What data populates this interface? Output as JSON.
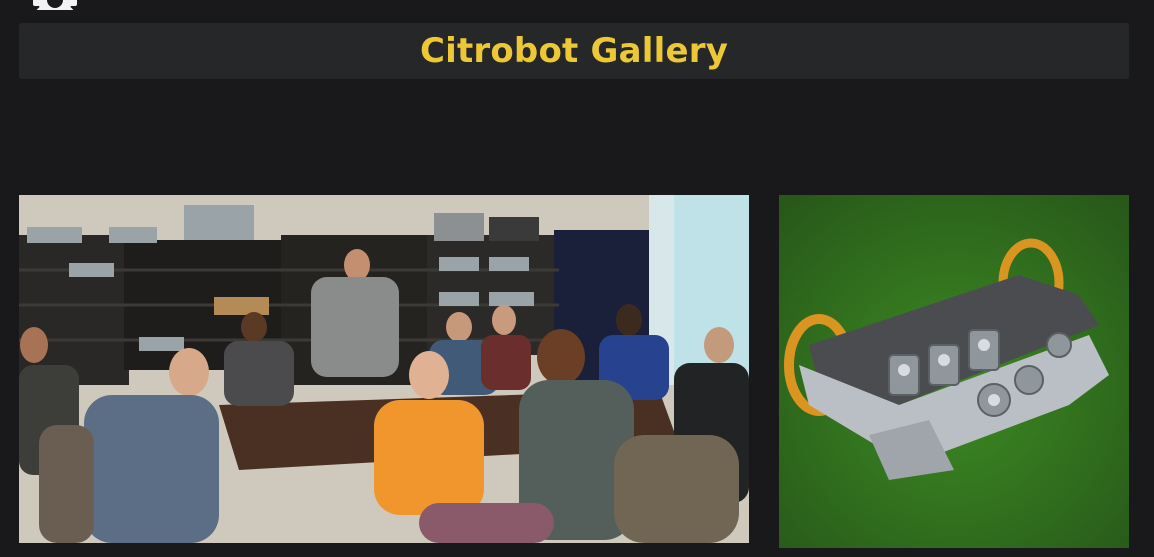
{
  "header": {
    "logo_icon": "gear-icon",
    "title": "Citrobot Gallery",
    "title_color": "#ecc836"
  },
  "gallery": {
    "items": [
      {
        "icon": "team-photo",
        "kind": "photograph"
      },
      {
        "icon": "robot-render",
        "kind": "3d-render"
      }
    ]
  },
  "colors": {
    "background": "#19191b",
    "title_bar": "#252728",
    "robot_backdrop": "#2f6a1b"
  }
}
